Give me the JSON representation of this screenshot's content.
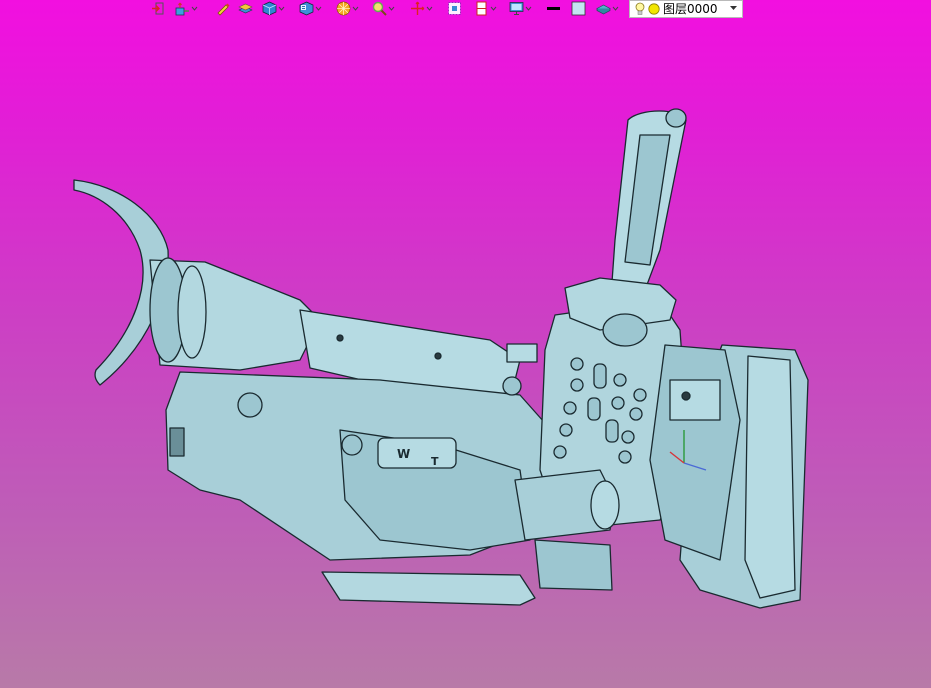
{
  "toolbar": {
    "tools": [
      {
        "icon": "exit-sketch-icon",
        "dropdown": false
      },
      {
        "icon": "user-coordinate-icon",
        "dropdown": true
      },
      {
        "icon": "highlight-pen-icon",
        "dropdown": false
      },
      {
        "icon": "layer-stack-icon",
        "dropdown": false
      },
      {
        "icon": "solid-cube-icon",
        "dropdown": true
      },
      {
        "icon": "view-orientation-icon",
        "dropdown": true
      },
      {
        "icon": "render-style-icon",
        "dropdown": true
      },
      {
        "icon": "zoom-icon",
        "dropdown": true
      },
      {
        "icon": "pan-icon",
        "dropdown": true
      },
      {
        "icon": "frame-select-icon",
        "dropdown": false
      },
      {
        "icon": "section-view-icon",
        "dropdown": true
      },
      {
        "icon": "monitor-display-icon",
        "dropdown": true
      },
      {
        "icon": "line-color-icon",
        "dropdown": false
      },
      {
        "icon": "fill-color-icon",
        "dropdown": false
      },
      {
        "icon": "surface-layer-icon",
        "dropdown": true
      }
    ]
  },
  "layer_selector": {
    "name": "图层0000",
    "bulb_color": "#fff8a0",
    "dot_color": "#f2e600"
  },
  "colors": {
    "background_top": "#f20fe0",
    "background_bottom": "#b87aa8",
    "model_fill": "#a8cfd8",
    "model_shade": "#7fb3c0",
    "model_edge": "#1a2a30"
  }
}
